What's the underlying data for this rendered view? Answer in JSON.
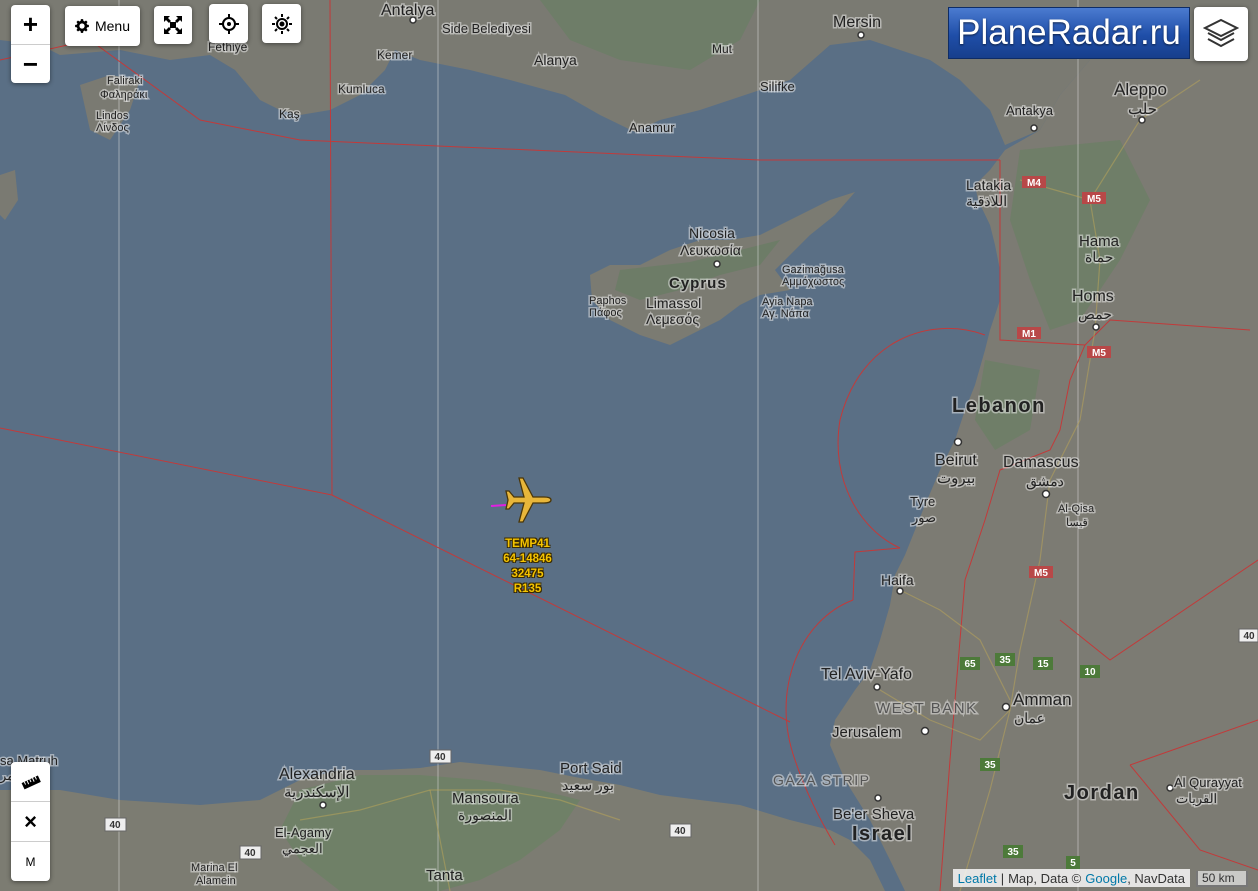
{
  "controls": {
    "zoom_in": "+",
    "zoom_out": "−",
    "menu_label": "Menu",
    "tool_m": "M",
    "tool_close": "×"
  },
  "logo": {
    "text": "PlaneRadar.ru"
  },
  "aircraft": {
    "callsign": "TEMP41",
    "registration": "64-14846",
    "altitude": "32475",
    "type": "R135",
    "icon": "airplane-icon",
    "color": "#e8b63a"
  },
  "places": {
    "antalya": "Antalya",
    "side": "Side Belediyesi",
    "mersin": "Mersin",
    "fethiye": "Fethiye",
    "kemer": "Kemer",
    "alanya": "Alanya",
    "mut": "Mut",
    "kumluca": "Kumluca",
    "kas": "Kaş",
    "silifke": "Silifke",
    "anamur": "Anamur",
    "antakya": "Antakya",
    "aleppo": "Aleppo",
    "aleppo_ar": "حلب",
    "faliraki": "Faliraki",
    "faliraki_gr": "Φαληράκι",
    "lindos": "Lindos",
    "lindos_gr": "Λίνδος",
    "latakia": "Latakia",
    "latakia_ar": "اللاذقية",
    "hama": "Hama",
    "hama_ar": "حماة",
    "nicosia": "Nicosia",
    "nicosia_gr": "Λευκωσία",
    "cyprus": "Cyprus",
    "gazimagusa": "Gazimağusa",
    "gazimagusa_gr": "Αμμόχωστος",
    "paphos": "Paphos",
    "paphos_gr": "Πάφος",
    "limassol": "Limassol",
    "limassol_gr": "Λεμεσός",
    "ayia_napa": "Ayia Napa",
    "ayia_napa_gr": "Αγ. Νάπα",
    "homs": "Homs",
    "homs_ar": "حمص",
    "lebanon": "Lebanon",
    "beirut": "Beirut",
    "beirut_ar": "بيروت",
    "damascus": "Damascus",
    "damascus_ar": "دمشق",
    "tyre": "Tyre",
    "tyre_ar": "صور",
    "al_qisa": "Al-Qisa",
    "al_qisa_ar": "قيسا",
    "haifa": "Haifa",
    "tel_aviv": "Tel Aviv-Yafo",
    "west_bank": "WEST BANK",
    "amman": "Amman",
    "amman_ar": "عمان",
    "jerusalem": "Jerusalem",
    "gaza": "GAZA STRIP",
    "beer_sheva": "Be'er Sheva",
    "israel": "Israel",
    "jordan": "Jordan",
    "al_qurayyat": "Al Qurayyat",
    "al_qurayyat_ar": "القريات",
    "marsa_matruh": "sa Matruh",
    "marsa_matruh_ar": "مر",
    "alexandria": "Alexandria",
    "alexandria_ar": "الإسكندرية",
    "port_said": "Port Said",
    "port_said_ar": "بور سعيد",
    "mansoura": "Mansoura",
    "mansoura_ar": "المنصورة",
    "el_agamy": "El-Agamy",
    "el_agamy_ar": "العجمي",
    "marina": "Marina El",
    "alamein": "Alamein",
    "tanta": "Tanta"
  },
  "road_shields": {
    "m4": "M4",
    "m5a": "M5",
    "m1": "M1",
    "m5b": "M5",
    "m5c": "M5",
    "r40a": "40",
    "r40b": "40",
    "r40c": "40",
    "r40d": "40",
    "r40e": "40",
    "r65": "65",
    "r35a": "35",
    "r15": "15",
    "r10": "10",
    "r35b": "35",
    "r35c": "35",
    "r5": "5"
  },
  "attribution": {
    "leaflet": "Leaflet",
    "sep": "|",
    "text": "Map, Data ©",
    "google": "Google",
    "navdata": ", NavData"
  },
  "scale": {
    "label": "50 km"
  }
}
